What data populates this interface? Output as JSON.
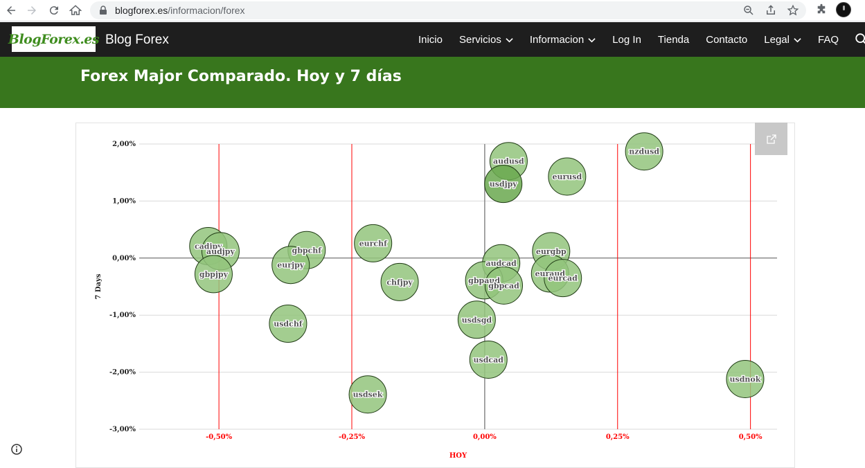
{
  "browser": {
    "url_domain": "blogforex.es",
    "url_path": "/informacion/forex"
  },
  "site": {
    "logo_text": "BlogForex.es",
    "name": "Blog Forex",
    "menu": [
      {
        "label": "Inicio",
        "dropdown": false
      },
      {
        "label": "Servicios",
        "dropdown": true
      },
      {
        "label": "Informacion",
        "dropdown": true
      },
      {
        "label": "Log In",
        "dropdown": false
      },
      {
        "label": "Tienda",
        "dropdown": false
      },
      {
        "label": "Contacto",
        "dropdown": false
      },
      {
        "label": "Legal",
        "dropdown": true
      },
      {
        "label": "FAQ",
        "dropdown": false
      }
    ]
  },
  "page": {
    "title": "Forex Major Comparado. Hoy y 7 días"
  },
  "colors": {
    "header_bg": "#1e1e1e",
    "banner_bg": "#38761d",
    "bubble_fill": "#93c47d",
    "bubble_highlight": "#6aa84f",
    "vline": "#ff0000",
    "xtick_color": "#ff0000"
  },
  "chart_data": {
    "type": "scatter",
    "xlabel": "HOY",
    "ylabel": "7 Days",
    "xlim": [
      -0.65,
      0.55
    ],
    "ylim": [
      -3.0,
      2.0
    ],
    "x_ticks": [
      {
        "value": -0.5,
        "label": "-0,50%"
      },
      {
        "value": -0.25,
        "label": "-0,25%"
      },
      {
        "value": 0.0,
        "label": "0,00%"
      },
      {
        "value": 0.25,
        "label": "0,25%"
      },
      {
        "value": 0.5,
        "label": "0,50%"
      }
    ],
    "y_ticks": [
      {
        "value": 2.0,
        "label": "2,00%"
      },
      {
        "value": 1.0,
        "label": "1,00%"
      },
      {
        "value": 0.0,
        "label": "0,00%"
      },
      {
        "value": -1.0,
        "label": "-1,00%"
      },
      {
        "value": -2.0,
        "label": "-2,00%"
      },
      {
        "value": -3.0,
        "label": "-3,00%"
      }
    ],
    "red_vlines": [
      -0.5,
      -0.25,
      0.25,
      0.5
    ],
    "points": [
      {
        "label": "nzdusd",
        "x": 0.3,
        "y": 1.87
      },
      {
        "label": "audusd",
        "x": 0.045,
        "y": 1.7
      },
      {
        "label": "eurusd",
        "x": 0.155,
        "y": 1.43
      },
      {
        "label": "usdjpy",
        "x": 0.035,
        "y": 1.3,
        "highlight": true
      },
      {
        "label": "cadjpy",
        "x": -0.52,
        "y": 0.21
      },
      {
        "label": "audjpy",
        "x": -0.497,
        "y": 0.12
      },
      {
        "label": "gbpchf",
        "x": -0.335,
        "y": 0.14
      },
      {
        "label": "eurjpy",
        "x": -0.365,
        "y": -0.12
      },
      {
        "label": "gbpjpy",
        "x": -0.51,
        "y": -0.28
      },
      {
        "label": "eurchf",
        "x": -0.21,
        "y": 0.26
      },
      {
        "label": "chfjpy",
        "x": -0.16,
        "y": -0.42
      },
      {
        "label": "eurgbp",
        "x": 0.125,
        "y": 0.12
      },
      {
        "label": "audcad",
        "x": 0.031,
        "y": -0.09
      },
      {
        "label": "euraud",
        "x": 0.123,
        "y": -0.27
      },
      {
        "label": "eurcad",
        "x": 0.147,
        "y": -0.35
      },
      {
        "label": "gbpaud",
        "x": -0.001,
        "y": -0.39
      },
      {
        "label": "gbpcad",
        "x": 0.036,
        "y": -0.48
      },
      {
        "label": "usdchf",
        "x": -0.37,
        "y": -1.15
      },
      {
        "label": "usdsgd",
        "x": -0.015,
        "y": -1.08
      },
      {
        "label": "usdcad",
        "x": 0.007,
        "y": -1.78
      },
      {
        "label": "usdsek",
        "x": -0.22,
        "y": -2.39
      },
      {
        "label": "usdnok",
        "x": 0.49,
        "y": -2.12
      }
    ]
  }
}
